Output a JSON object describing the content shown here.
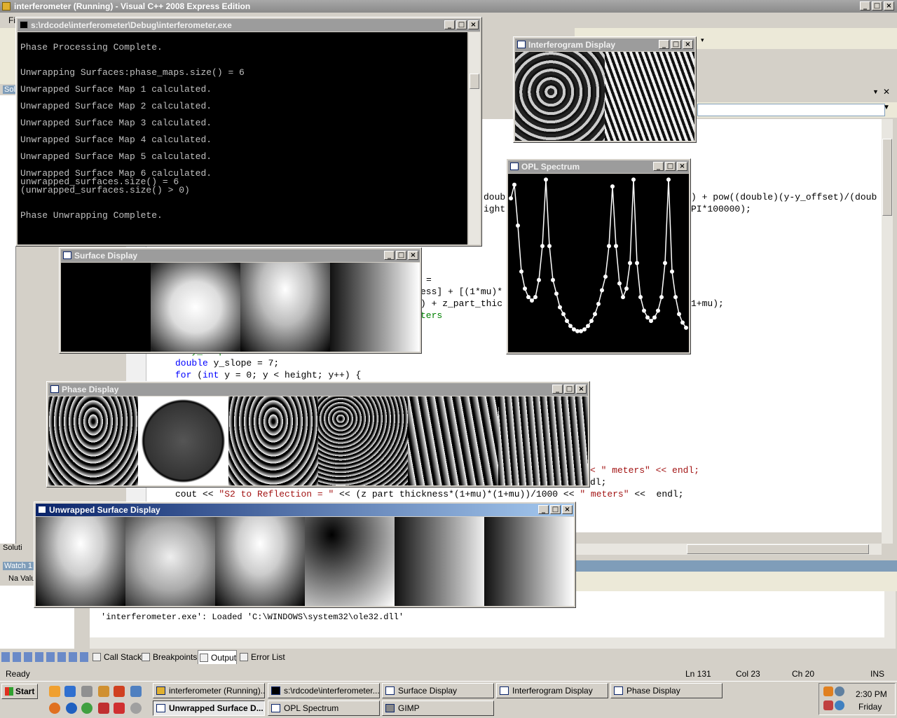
{
  "ide": {
    "title": "interferometer (Running) - Visual C++ 2008 Express Edition",
    "menu_first": "Fil",
    "sol_label": "Solu",
    "sol_tab": "Soluti",
    "watch_label": "Watch 1",
    "watch_cols": "Na Valu",
    "code_lines": [
      {
        "pre": "doubl",
        "rest": ""
      },
      {
        "pre": "ight",
        "rest": ""
      },
      {
        "pre": "=",
        "rest": ""
      },
      {
        "pre": "ess] + [(1*mu)*",
        "rest": ""
      },
      {
        "pre": ") + z_part_thic",
        "rest": ""
      },
      {
        "pre": "ters",
        "rest": ""
      }
    ],
    "code_right": [
      ") + pow((double)(y-y_offset)/(doub",
      "PI*100000);",
      "1+mu);"
    ],
    "code_main": {
      "comment": "// y_slope",
      "line1_kw": "double",
      "line1": " y_slope = 7;",
      "line2_kw": "for",
      "line2_a": " (",
      "line2_kw2": "int",
      "line2_b": " y = 0; y < height; y++) {",
      "meters_line": "< \" meters\" << endl;",
      "endl_line": "dl;",
      "cout_a": "cout << ",
      "cout_str": "\"S2 to Reflection = \"",
      "cout_b": " << (z part thickness*(1+mu)*(1+mu))/1000 << ",
      "cout_str2": "\" meters\"",
      "cout_c": " <<  endl;"
    },
    "output_line": "'interferometer.exe': Loaded 'C:\\WINDOWS\\system32\\ole32.dll'",
    "tabs": [
      "Call Stack",
      "Breakpoints",
      "Output",
      "Error List"
    ],
    "status": {
      "ready": "Ready",
      "ln": "Ln 131",
      "col": "Col 23",
      "ch": "Ch 20",
      "ins": "INS"
    }
  },
  "console": {
    "title": "s:\\rdcode\\interferometer\\Debug\\interferometer.exe",
    "lines": [
      "",
      "Phase Processing Complete.",
      "",
      "",
      "Unwrapping Surfaces:phase_maps.size() = 6",
      "",
      "Unwrapped Surface Map 1 calculated.",
      "",
      "Unwrapped Surface Map 2 calculated.",
      "",
      "Unwrapped Surface Map 3 calculated.",
      "",
      "Unwrapped Surface Map 4 calculated.",
      "",
      "Unwrapped Surface Map 5 calculated.",
      "",
      "Unwrapped Surface Map 6 calculated.",
      "unwrapped_surfaces.size() = 6",
      "(unwrapped_surfaces.size() > 0)",
      "",
      "",
      "Phase Unwrapping Complete."
    ]
  },
  "windows": {
    "interferogram": "Interferogram Display",
    "opl": "OPL Spectrum",
    "surface": "Surface Display",
    "phase": "Phase Display",
    "unwrapped": "Unwrapped Surface Display"
  },
  "taskbar": {
    "start": "Start",
    "buttons": [
      "interferometer (Running)...",
      "s:\\rdcode\\interferometer...",
      "Surface Display",
      "Interferogram Display",
      "Phase Display",
      "Unwrapped Surface D...",
      "OPL Spectrum",
      "GIMP"
    ],
    "time": "2:30 PM",
    "day": "Friday"
  },
  "chart_data": {
    "type": "line",
    "title": "OPL Spectrum",
    "series": [
      {
        "x": [
          0,
          2,
          4,
          6,
          8,
          10,
          12,
          14,
          16,
          18,
          20,
          22,
          24,
          26,
          28,
          30,
          32,
          34,
          36,
          38,
          40,
          42,
          44,
          46,
          48,
          50,
          52,
          54,
          56,
          58,
          60,
          62,
          64,
          66,
          68,
          70,
          72,
          74,
          76,
          78,
          80,
          82,
          84,
          86,
          88,
          90,
          92,
          94,
          96,
          98,
          100
        ],
        "y": [
          0.88,
          0.96,
          0.72,
          0.45,
          0.35,
          0.3,
          0.28,
          0.3,
          0.4,
          0.6,
          0.99,
          0.6,
          0.4,
          0.32,
          0.24,
          0.2,
          0.16,
          0.13,
          0.11,
          0.1,
          0.1,
          0.11,
          0.13,
          0.16,
          0.2,
          0.26,
          0.34,
          0.42,
          0.6,
          0.95,
          0.6,
          0.38,
          0.3,
          0.35,
          0.5,
          0.99,
          0.5,
          0.3,
          0.22,
          0.18,
          0.16,
          0.18,
          0.22,
          0.3,
          0.5,
          0.99,
          0.45,
          0.3,
          0.2,
          0.15,
          0.12
        ]
      }
    ]
  }
}
